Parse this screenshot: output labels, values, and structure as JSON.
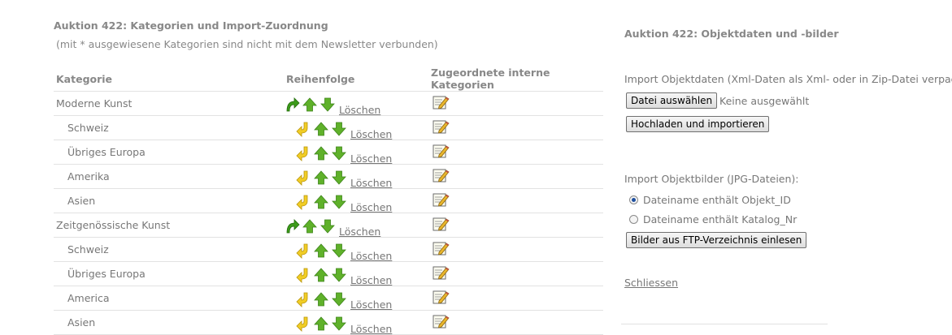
{
  "left": {
    "title": "Auktion 422: Kategorien und Import-Zuordnung",
    "note": "(mit * ausgewiesene Kategorien sind nicht mit dem Newsletter verbunden)",
    "headers": [
      "Kategorie",
      "Reihenfolge",
      "Zugeordnete interne Kategorien"
    ],
    "rows": [
      {
        "name": "Moderne Kunst",
        "level": 0,
        "action": "Löschen"
      },
      {
        "name": "Schweiz",
        "level": 1,
        "action": "Löschen"
      },
      {
        "name": "Übriges Europa",
        "level": 1,
        "action": "Löschen"
      },
      {
        "name": "Amerika",
        "level": 1,
        "action": "Löschen"
      },
      {
        "name": "Asien",
        "level": 1,
        "action": "Löschen"
      },
      {
        "name": "Zeitgenössische Kunst",
        "level": 0,
        "action": "Löschen"
      },
      {
        "name": "Schweiz",
        "level": 1,
        "action": "Löschen"
      },
      {
        "name": "Übriges Europa",
        "level": 1,
        "action": "Löschen"
      },
      {
        "name": "America",
        "level": 1,
        "action": "Löschen"
      },
      {
        "name": "Asien",
        "level": 1,
        "action": "Löschen"
      }
    ]
  },
  "right": {
    "title": "Auktion 422: Objektdaten und -bilder",
    "import_data_label": "Import Objektdaten (Xml-Daten als Xml- oder in Zip-Datei verpackt",
    "choose_file_button": "Datei auswählen",
    "no_file_text": "Keine ausgewählt",
    "upload_button": "Hochladen und importieren",
    "import_images_label": "Import Objektbilder (JPG-Dateien):",
    "radio_options": [
      {
        "label": "Dateiname enthält Objekt_ID",
        "checked": true
      },
      {
        "label": "Dateiname enthält Katalog_Nr",
        "checked": false
      }
    ],
    "ftp_button": "Bilder aus FTP-Verzeichnis einlesen",
    "close_link": "Schliessen"
  },
  "colors": {
    "text": "#777777",
    "header_text": "#888888",
    "row_border": "#e2e2e2",
    "arrow_green": "#5fb12a",
    "indent_yellow": "#e8c21a",
    "outdent_green": "#3c9b1a"
  },
  "icons": {
    "level0_move": "outdent-arrow-icon",
    "level1_move": "indent-arrow-icon",
    "up": "arrow-up-icon",
    "down": "arrow-down-icon",
    "edit": "edit-note-icon"
  }
}
